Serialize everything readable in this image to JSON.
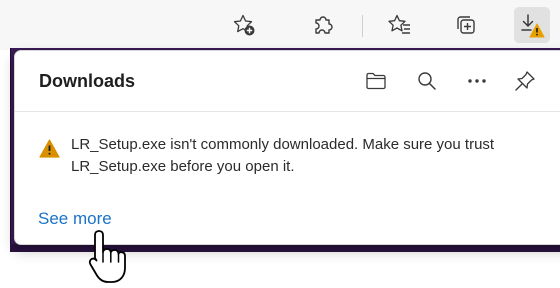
{
  "toolbar": {
    "buttons": [
      {
        "name": "favorites-add-icon",
        "label": "Add this page to favorites"
      },
      {
        "name": "extensions-icon",
        "label": "Extensions"
      },
      {
        "name": "favorites-icon",
        "label": "Favorites"
      },
      {
        "name": "collections-icon",
        "label": "Collections"
      },
      {
        "name": "downloads-warning-icon",
        "label": "Downloads"
      }
    ],
    "active_button": "downloads-warning-icon"
  },
  "downloads_panel": {
    "title": "Downloads",
    "actions": [
      {
        "icon": "open-folder-icon"
      },
      {
        "icon": "search-icon"
      },
      {
        "icon": "more-options-icon"
      },
      {
        "icon": "pin-icon"
      }
    ],
    "warning": {
      "icon": "warning-icon",
      "message": "LR_Setup.exe isn't commonly downloaded. Make sure you trust LR_Setup.exe before you open it."
    },
    "see_more_label": "See more"
  },
  "colors": {
    "accent_link": "#1a73c5",
    "warning": "#d99000",
    "page_background": "#3b1b57"
  },
  "cursor": {
    "icon": "hand-pointer-icon"
  }
}
